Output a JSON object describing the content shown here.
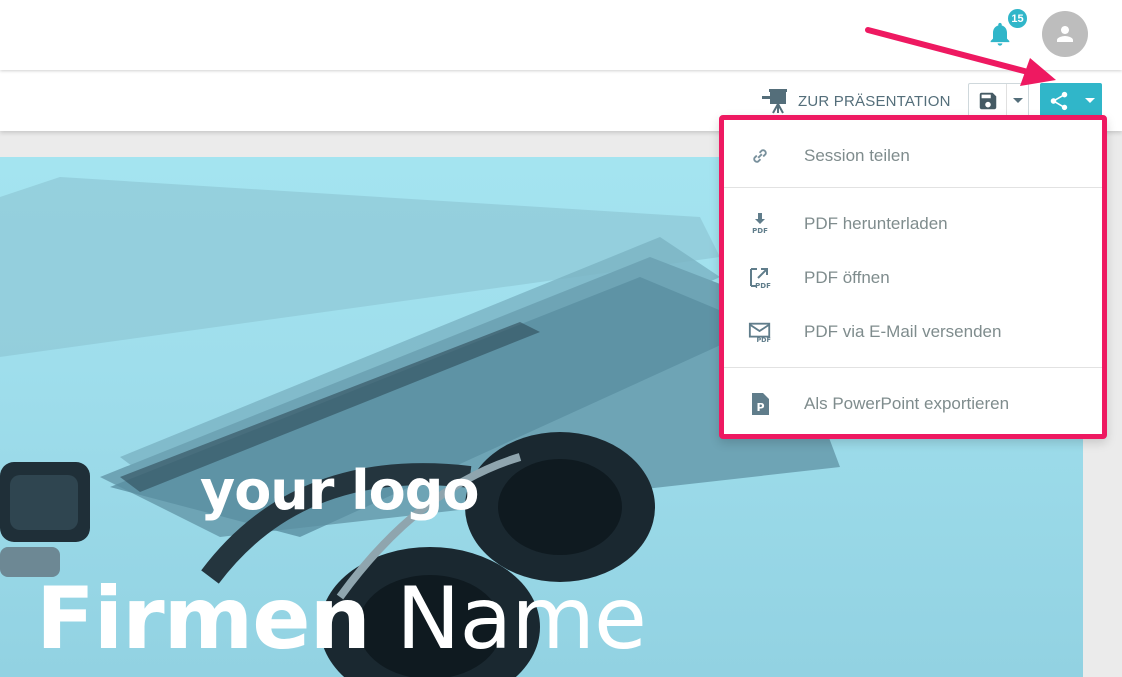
{
  "header": {
    "notification_count": "15",
    "accent_color": "#30b6c9"
  },
  "toolbar": {
    "present_label": "ZUR PRÄSENTATION"
  },
  "share_menu": {
    "items": [
      {
        "label": "Session teilen",
        "icon": "link-icon"
      },
      {
        "label": "PDF herunterladen",
        "icon": "pdf-download-icon"
      },
      {
        "label": "PDF öffnen",
        "icon": "pdf-open-icon"
      },
      {
        "label": "PDF via E-Mail versenden",
        "icon": "pdf-mail-icon"
      },
      {
        "label": "Als PowerPoint exportieren",
        "icon": "powerpoint-icon"
      }
    ],
    "highlight_color": "#ee1961"
  },
  "slide": {
    "logo_text": "your logo",
    "company_bold": "Firmen",
    "company_light": "Name"
  }
}
